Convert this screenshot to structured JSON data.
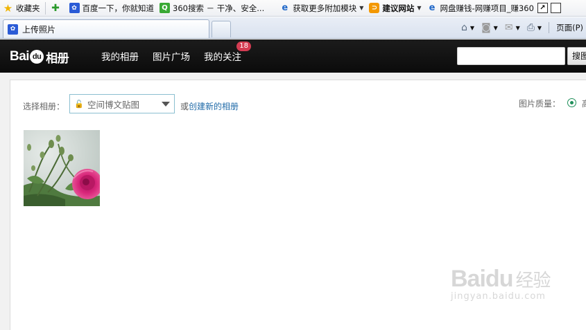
{
  "favorites": {
    "items": [
      {
        "icon": "star-icon",
        "label": "收藏夹"
      },
      {
        "icon": "baidu-paw-icon",
        "label": "百度一下，你就知道"
      },
      {
        "icon": "360-search-icon",
        "label": "360搜索 － 干净、安全..."
      },
      {
        "icon": "ie-icon",
        "label": "获取更多附加模块"
      },
      {
        "icon": "suggest-site-icon",
        "label": "建议网站"
      },
      {
        "icon": "ie-icon",
        "label": "网盘赚钱-网赚项目_赚360"
      }
    ]
  },
  "tab": {
    "title": "上传照片"
  },
  "commandbar": {
    "page_label": "页面(P)"
  },
  "site": {
    "logo_text": "Bai",
    "logo_paw": "du",
    "logo_suffix": "相册",
    "nav": [
      {
        "label": "我的相册"
      },
      {
        "label": "图片广场"
      },
      {
        "label": "我的关注",
        "badge": "18"
      }
    ],
    "search_button": "搜图"
  },
  "upload": {
    "album_label": "选择相册：",
    "album_selected": "空间博文贴图",
    "or_text": "或",
    "create_link": "创建新的相册",
    "quality_label": "图片质量：",
    "quality_option": "高"
  },
  "watermark": {
    "logo": "Bai",
    "logo_paw": "du",
    "logo_suffix": "经验",
    "url": "jingyan.baidu.com"
  }
}
